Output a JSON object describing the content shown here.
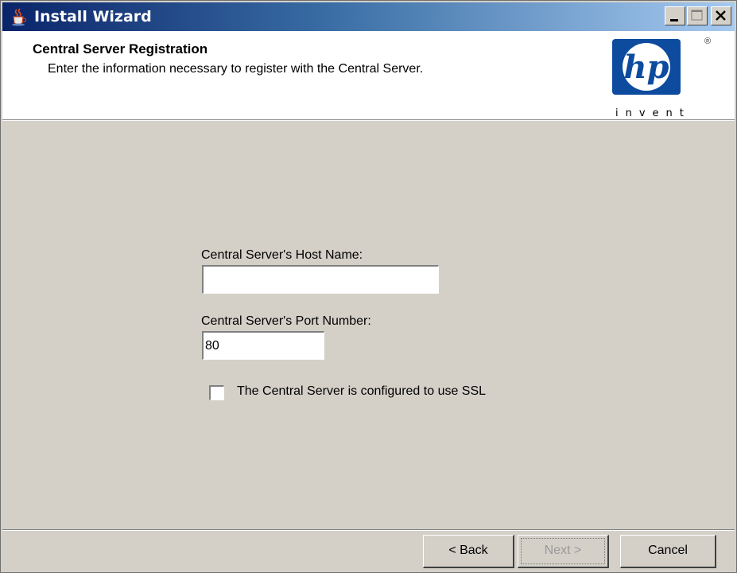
{
  "window": {
    "title": "Install Wizard",
    "icon": "java-cup-icon",
    "controls": [
      "minimize-icon",
      "maximize-icon",
      "close-icon"
    ]
  },
  "header": {
    "title": "Central Server Registration",
    "subtitle": "Enter the information necessary to register with the Central Server.",
    "logo": {
      "text": "hp",
      "tagline": "invent",
      "registered_mark": "®",
      "color": "#0d4b9e"
    }
  },
  "form": {
    "host": {
      "label": "Central Server's Host Name:",
      "value": ""
    },
    "port": {
      "label": "Central Server's Port Number:",
      "value": "80"
    },
    "ssl": {
      "label": "The Central Server is configured to use SSL",
      "checked": false
    }
  },
  "footer": {
    "back_label": "< Back",
    "next_label": "Next >",
    "next_enabled": false,
    "cancel_label": "Cancel"
  },
  "colors": {
    "titlebar_start": "#0a246a",
    "titlebar_end": "#a6caf0",
    "dialog_face": "#d4d0c8",
    "disabled_text": "#9a9a9a"
  }
}
